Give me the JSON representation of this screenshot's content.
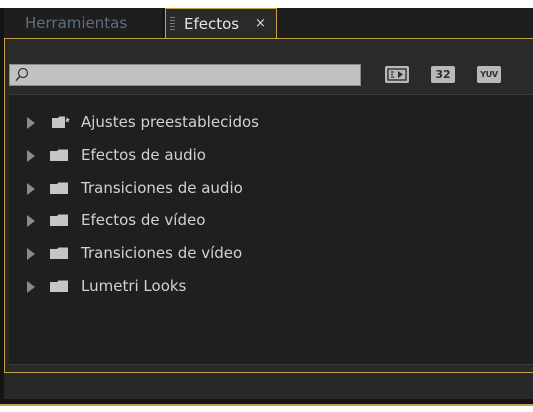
{
  "tabs": {
    "herramientas_label": "Herramientas",
    "efectos_label": "Efectos",
    "close_glyph": "×"
  },
  "search": {
    "value": "",
    "placeholder": ""
  },
  "filter_buttons": {
    "accelerated_icon": "accelerated-effects-icon",
    "bit32_label": "32",
    "yuv_label": "YUV"
  },
  "tree": {
    "items": [
      {
        "label": "Ajustes preestablecidos",
        "icon": "preset-folder-icon",
        "expanded": false
      },
      {
        "label": "Efectos de audio",
        "icon": "folder-icon",
        "expanded": false
      },
      {
        "label": "Transiciones de audio",
        "icon": "folder-icon",
        "expanded": false
      },
      {
        "label": "Efectos de vídeo",
        "icon": "folder-icon",
        "expanded": false
      },
      {
        "label": "Transiciones de vídeo",
        "icon": "folder-icon",
        "expanded": false
      },
      {
        "label": "Lumetri Looks",
        "icon": "folder-icon",
        "expanded": false
      }
    ]
  },
  "colors": {
    "accent": "#c8a04a",
    "panel_bg": "#2a2a2a",
    "list_bg": "#1f1f1f",
    "text": "#d2d2d2",
    "inactive_tab_text": "#5f6f80"
  }
}
